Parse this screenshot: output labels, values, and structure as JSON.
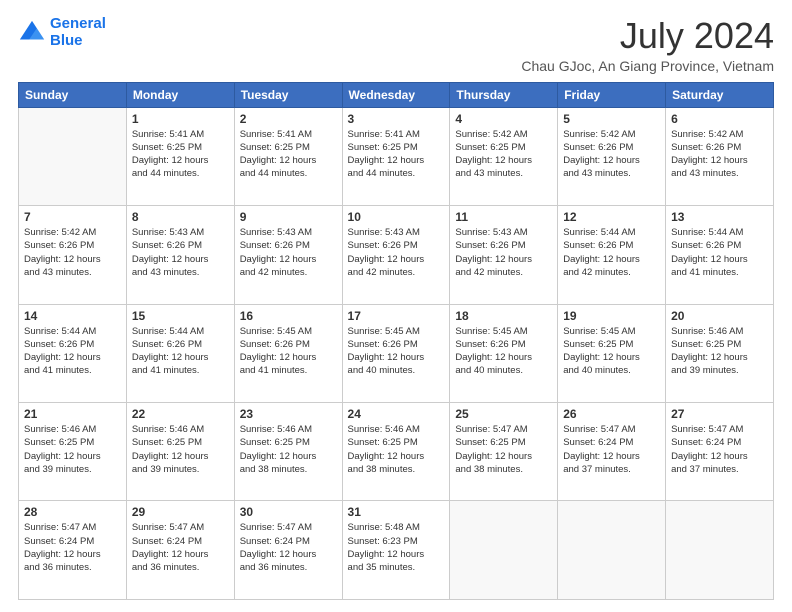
{
  "logo": {
    "line1": "General",
    "line2": "Blue"
  },
  "title": "July 2024",
  "subtitle": "Chau GJoc, An Giang Province, Vietnam",
  "days_header": [
    "Sunday",
    "Monday",
    "Tuesday",
    "Wednesday",
    "Thursday",
    "Friday",
    "Saturday"
  ],
  "weeks": [
    [
      {
        "day": "",
        "info": ""
      },
      {
        "day": "1",
        "info": "Sunrise: 5:41 AM\nSunset: 6:25 PM\nDaylight: 12 hours\nand 44 minutes."
      },
      {
        "day": "2",
        "info": "Sunrise: 5:41 AM\nSunset: 6:25 PM\nDaylight: 12 hours\nand 44 minutes."
      },
      {
        "day": "3",
        "info": "Sunrise: 5:41 AM\nSunset: 6:25 PM\nDaylight: 12 hours\nand 44 minutes."
      },
      {
        "day": "4",
        "info": "Sunrise: 5:42 AM\nSunset: 6:25 PM\nDaylight: 12 hours\nand 43 minutes."
      },
      {
        "day": "5",
        "info": "Sunrise: 5:42 AM\nSunset: 6:26 PM\nDaylight: 12 hours\nand 43 minutes."
      },
      {
        "day": "6",
        "info": "Sunrise: 5:42 AM\nSunset: 6:26 PM\nDaylight: 12 hours\nand 43 minutes."
      }
    ],
    [
      {
        "day": "7",
        "info": "Sunrise: 5:42 AM\nSunset: 6:26 PM\nDaylight: 12 hours\nand 43 minutes."
      },
      {
        "day": "8",
        "info": "Sunrise: 5:43 AM\nSunset: 6:26 PM\nDaylight: 12 hours\nand 43 minutes."
      },
      {
        "day": "9",
        "info": "Sunrise: 5:43 AM\nSunset: 6:26 PM\nDaylight: 12 hours\nand 42 minutes."
      },
      {
        "day": "10",
        "info": "Sunrise: 5:43 AM\nSunset: 6:26 PM\nDaylight: 12 hours\nand 42 minutes."
      },
      {
        "day": "11",
        "info": "Sunrise: 5:43 AM\nSunset: 6:26 PM\nDaylight: 12 hours\nand 42 minutes."
      },
      {
        "day": "12",
        "info": "Sunrise: 5:44 AM\nSunset: 6:26 PM\nDaylight: 12 hours\nand 42 minutes."
      },
      {
        "day": "13",
        "info": "Sunrise: 5:44 AM\nSunset: 6:26 PM\nDaylight: 12 hours\nand 41 minutes."
      }
    ],
    [
      {
        "day": "14",
        "info": "Sunrise: 5:44 AM\nSunset: 6:26 PM\nDaylight: 12 hours\nand 41 minutes."
      },
      {
        "day": "15",
        "info": "Sunrise: 5:44 AM\nSunset: 6:26 PM\nDaylight: 12 hours\nand 41 minutes."
      },
      {
        "day": "16",
        "info": "Sunrise: 5:45 AM\nSunset: 6:26 PM\nDaylight: 12 hours\nand 41 minutes."
      },
      {
        "day": "17",
        "info": "Sunrise: 5:45 AM\nSunset: 6:26 PM\nDaylight: 12 hours\nand 40 minutes."
      },
      {
        "day": "18",
        "info": "Sunrise: 5:45 AM\nSunset: 6:26 PM\nDaylight: 12 hours\nand 40 minutes."
      },
      {
        "day": "19",
        "info": "Sunrise: 5:45 AM\nSunset: 6:25 PM\nDaylight: 12 hours\nand 40 minutes."
      },
      {
        "day": "20",
        "info": "Sunrise: 5:46 AM\nSunset: 6:25 PM\nDaylight: 12 hours\nand 39 minutes."
      }
    ],
    [
      {
        "day": "21",
        "info": "Sunrise: 5:46 AM\nSunset: 6:25 PM\nDaylight: 12 hours\nand 39 minutes."
      },
      {
        "day": "22",
        "info": "Sunrise: 5:46 AM\nSunset: 6:25 PM\nDaylight: 12 hours\nand 39 minutes."
      },
      {
        "day": "23",
        "info": "Sunrise: 5:46 AM\nSunset: 6:25 PM\nDaylight: 12 hours\nand 38 minutes."
      },
      {
        "day": "24",
        "info": "Sunrise: 5:46 AM\nSunset: 6:25 PM\nDaylight: 12 hours\nand 38 minutes."
      },
      {
        "day": "25",
        "info": "Sunrise: 5:47 AM\nSunset: 6:25 PM\nDaylight: 12 hours\nand 38 minutes."
      },
      {
        "day": "26",
        "info": "Sunrise: 5:47 AM\nSunset: 6:24 PM\nDaylight: 12 hours\nand 37 minutes."
      },
      {
        "day": "27",
        "info": "Sunrise: 5:47 AM\nSunset: 6:24 PM\nDaylight: 12 hours\nand 37 minutes."
      }
    ],
    [
      {
        "day": "28",
        "info": "Sunrise: 5:47 AM\nSunset: 6:24 PM\nDaylight: 12 hours\nand 36 minutes."
      },
      {
        "day": "29",
        "info": "Sunrise: 5:47 AM\nSunset: 6:24 PM\nDaylight: 12 hours\nand 36 minutes."
      },
      {
        "day": "30",
        "info": "Sunrise: 5:47 AM\nSunset: 6:24 PM\nDaylight: 12 hours\nand 36 minutes."
      },
      {
        "day": "31",
        "info": "Sunrise: 5:48 AM\nSunset: 6:23 PM\nDaylight: 12 hours\nand 35 minutes."
      },
      {
        "day": "",
        "info": ""
      },
      {
        "day": "",
        "info": ""
      },
      {
        "day": "",
        "info": ""
      }
    ]
  ]
}
